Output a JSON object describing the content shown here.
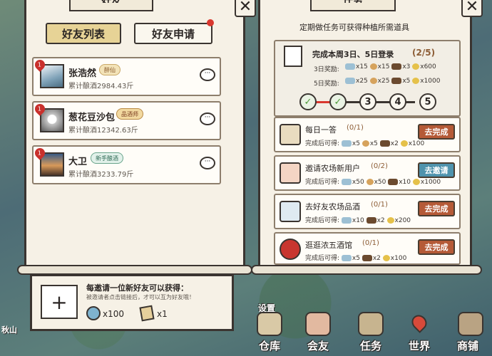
{
  "left": {
    "title": "好友",
    "tabs": [
      {
        "label": "好友列表",
        "active": true
      },
      {
        "label": "好友申请",
        "active": false
      }
    ],
    "friends": [
      {
        "name": "张浩然",
        "badge": "醉仙",
        "stat": "累计酿酒2984.43斤",
        "level": "1"
      },
      {
        "name": "葱花豆沙包",
        "badge": "品酒师",
        "stat": "累计酿酒12342.63斤",
        "level": "1"
      },
      {
        "name": "大卫",
        "badge": "新手酿酒",
        "stat": "累计酿酒3233.79斤",
        "level": "1"
      }
    ],
    "invite": {
      "title": "每邀请一位新好友可以获得：",
      "subtitle": "被邀请者点击链接后，才可以互为好友哦！",
      "rewards": [
        {
          "icon": "water-drop-icon",
          "amount": "x100"
        },
        {
          "icon": "scroll-icon",
          "amount": "x1"
        }
      ]
    }
  },
  "right": {
    "title": "任务",
    "subtitle": "定期做任务可获得种植所需道具",
    "login": {
      "title": "完成本周3日、5日登录",
      "progress": "(2/5)",
      "day3_label": "3日奖励:",
      "day3_rewards": [
        "x15",
        "x15",
        "x3",
        "x600"
      ],
      "day5_label": "5日奖励:",
      "day5_rewards": [
        "x25",
        "x25",
        "x5",
        "x1000"
      ],
      "steps": [
        {
          "value": "✓",
          "done": true
        },
        {
          "value": "✓",
          "done": true
        },
        {
          "value": "3",
          "done": false
        },
        {
          "value": "4",
          "done": false
        },
        {
          "value": "5",
          "done": false
        }
      ]
    },
    "reward_prefix": "完成后可得:",
    "tasks": [
      {
        "name": "每日一答",
        "progress": "(0/1)",
        "rewards": [
          "x5",
          "x5",
          "x2",
          "x100"
        ],
        "button": "去完成",
        "button_color": "#b55a37"
      },
      {
        "name": "邀请农场新用户",
        "progress": "(0/2)",
        "rewards": [
          "x50",
          "x50",
          "x10",
          "x1000"
        ],
        "button": "去邀请",
        "button_color": "#4f93ad"
      },
      {
        "name": "去好友农场品酒",
        "progress": "(0/1)",
        "rewards": [
          "x10",
          "x2",
          "x200"
        ],
        "button": "去完成",
        "button_color": "#b55a37"
      },
      {
        "name": "逛逛浓五酒馆",
        "progress": "(0/1)",
        "rewards": [
          "x5",
          "x2",
          "x100"
        ],
        "button": "去完成",
        "button_color": "#b55a37"
      }
    ]
  },
  "nav": [
    {
      "label": "仓库",
      "icon": "warehouse-icon"
    },
    {
      "label": "会友",
      "icon": "friends-icon"
    },
    {
      "label": "任务",
      "icon": "task-icon"
    },
    {
      "label": "世界",
      "icon": "world-icon"
    },
    {
      "label": "商铺",
      "icon": "shop-icon"
    }
  ],
  "corner_labels": {
    "settings": "设置",
    "left_edge": "秋山"
  },
  "colors": {
    "accent_red": "#b55a37",
    "accent_blue": "#4f93ad",
    "tab_active": "#e7d396"
  }
}
